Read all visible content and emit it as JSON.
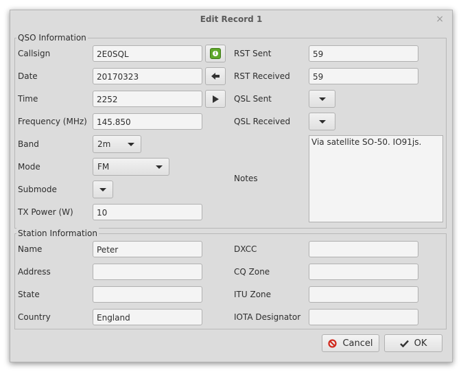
{
  "window": {
    "title": "Edit Record 1",
    "close": "×"
  },
  "qso": {
    "group_label": "QSO Information",
    "callsign": {
      "label": "Callsign",
      "value": "2E0SQL"
    },
    "date": {
      "label": "Date",
      "value": "20170323"
    },
    "time": {
      "label": "Time",
      "value": "2252"
    },
    "frequency": {
      "label": "Frequency (MHz)",
      "value": "145.850"
    },
    "band": {
      "label": "Band",
      "value": "2m"
    },
    "mode": {
      "label": "Mode",
      "value": "FM"
    },
    "submode": {
      "label": "Submode",
      "value": ""
    },
    "tx_power": {
      "label": "TX Power (W)",
      "value": "10"
    },
    "rst_sent": {
      "label": "RST Sent",
      "value": "59"
    },
    "rst_received": {
      "label": "RST Received",
      "value": "59"
    },
    "qsl_sent": {
      "label": "QSL Sent",
      "value": ""
    },
    "qsl_received": {
      "label": "QSL Received",
      "value": ""
    },
    "notes": {
      "label": "Notes",
      "value": "Via satellite SO-50. IO91js."
    }
  },
  "station": {
    "group_label": "Station Information",
    "name": {
      "label": "Name",
      "value": "Peter"
    },
    "address": {
      "label": "Address",
      "value": ""
    },
    "state": {
      "label": "State",
      "value": ""
    },
    "country": {
      "label": "Country",
      "value": "England"
    },
    "dxcc": {
      "label": "DXCC",
      "value": ""
    },
    "cq_zone": {
      "label": "CQ Zone",
      "value": ""
    },
    "itu_zone": {
      "label": "ITU Zone",
      "value": ""
    },
    "iota": {
      "label": "IOTA Designator",
      "value": ""
    }
  },
  "buttons": {
    "cancel": "Cancel",
    "ok": "OK"
  },
  "colors": {
    "lookup_green": "#5fa82a",
    "cancel_red": "#d0281c"
  }
}
